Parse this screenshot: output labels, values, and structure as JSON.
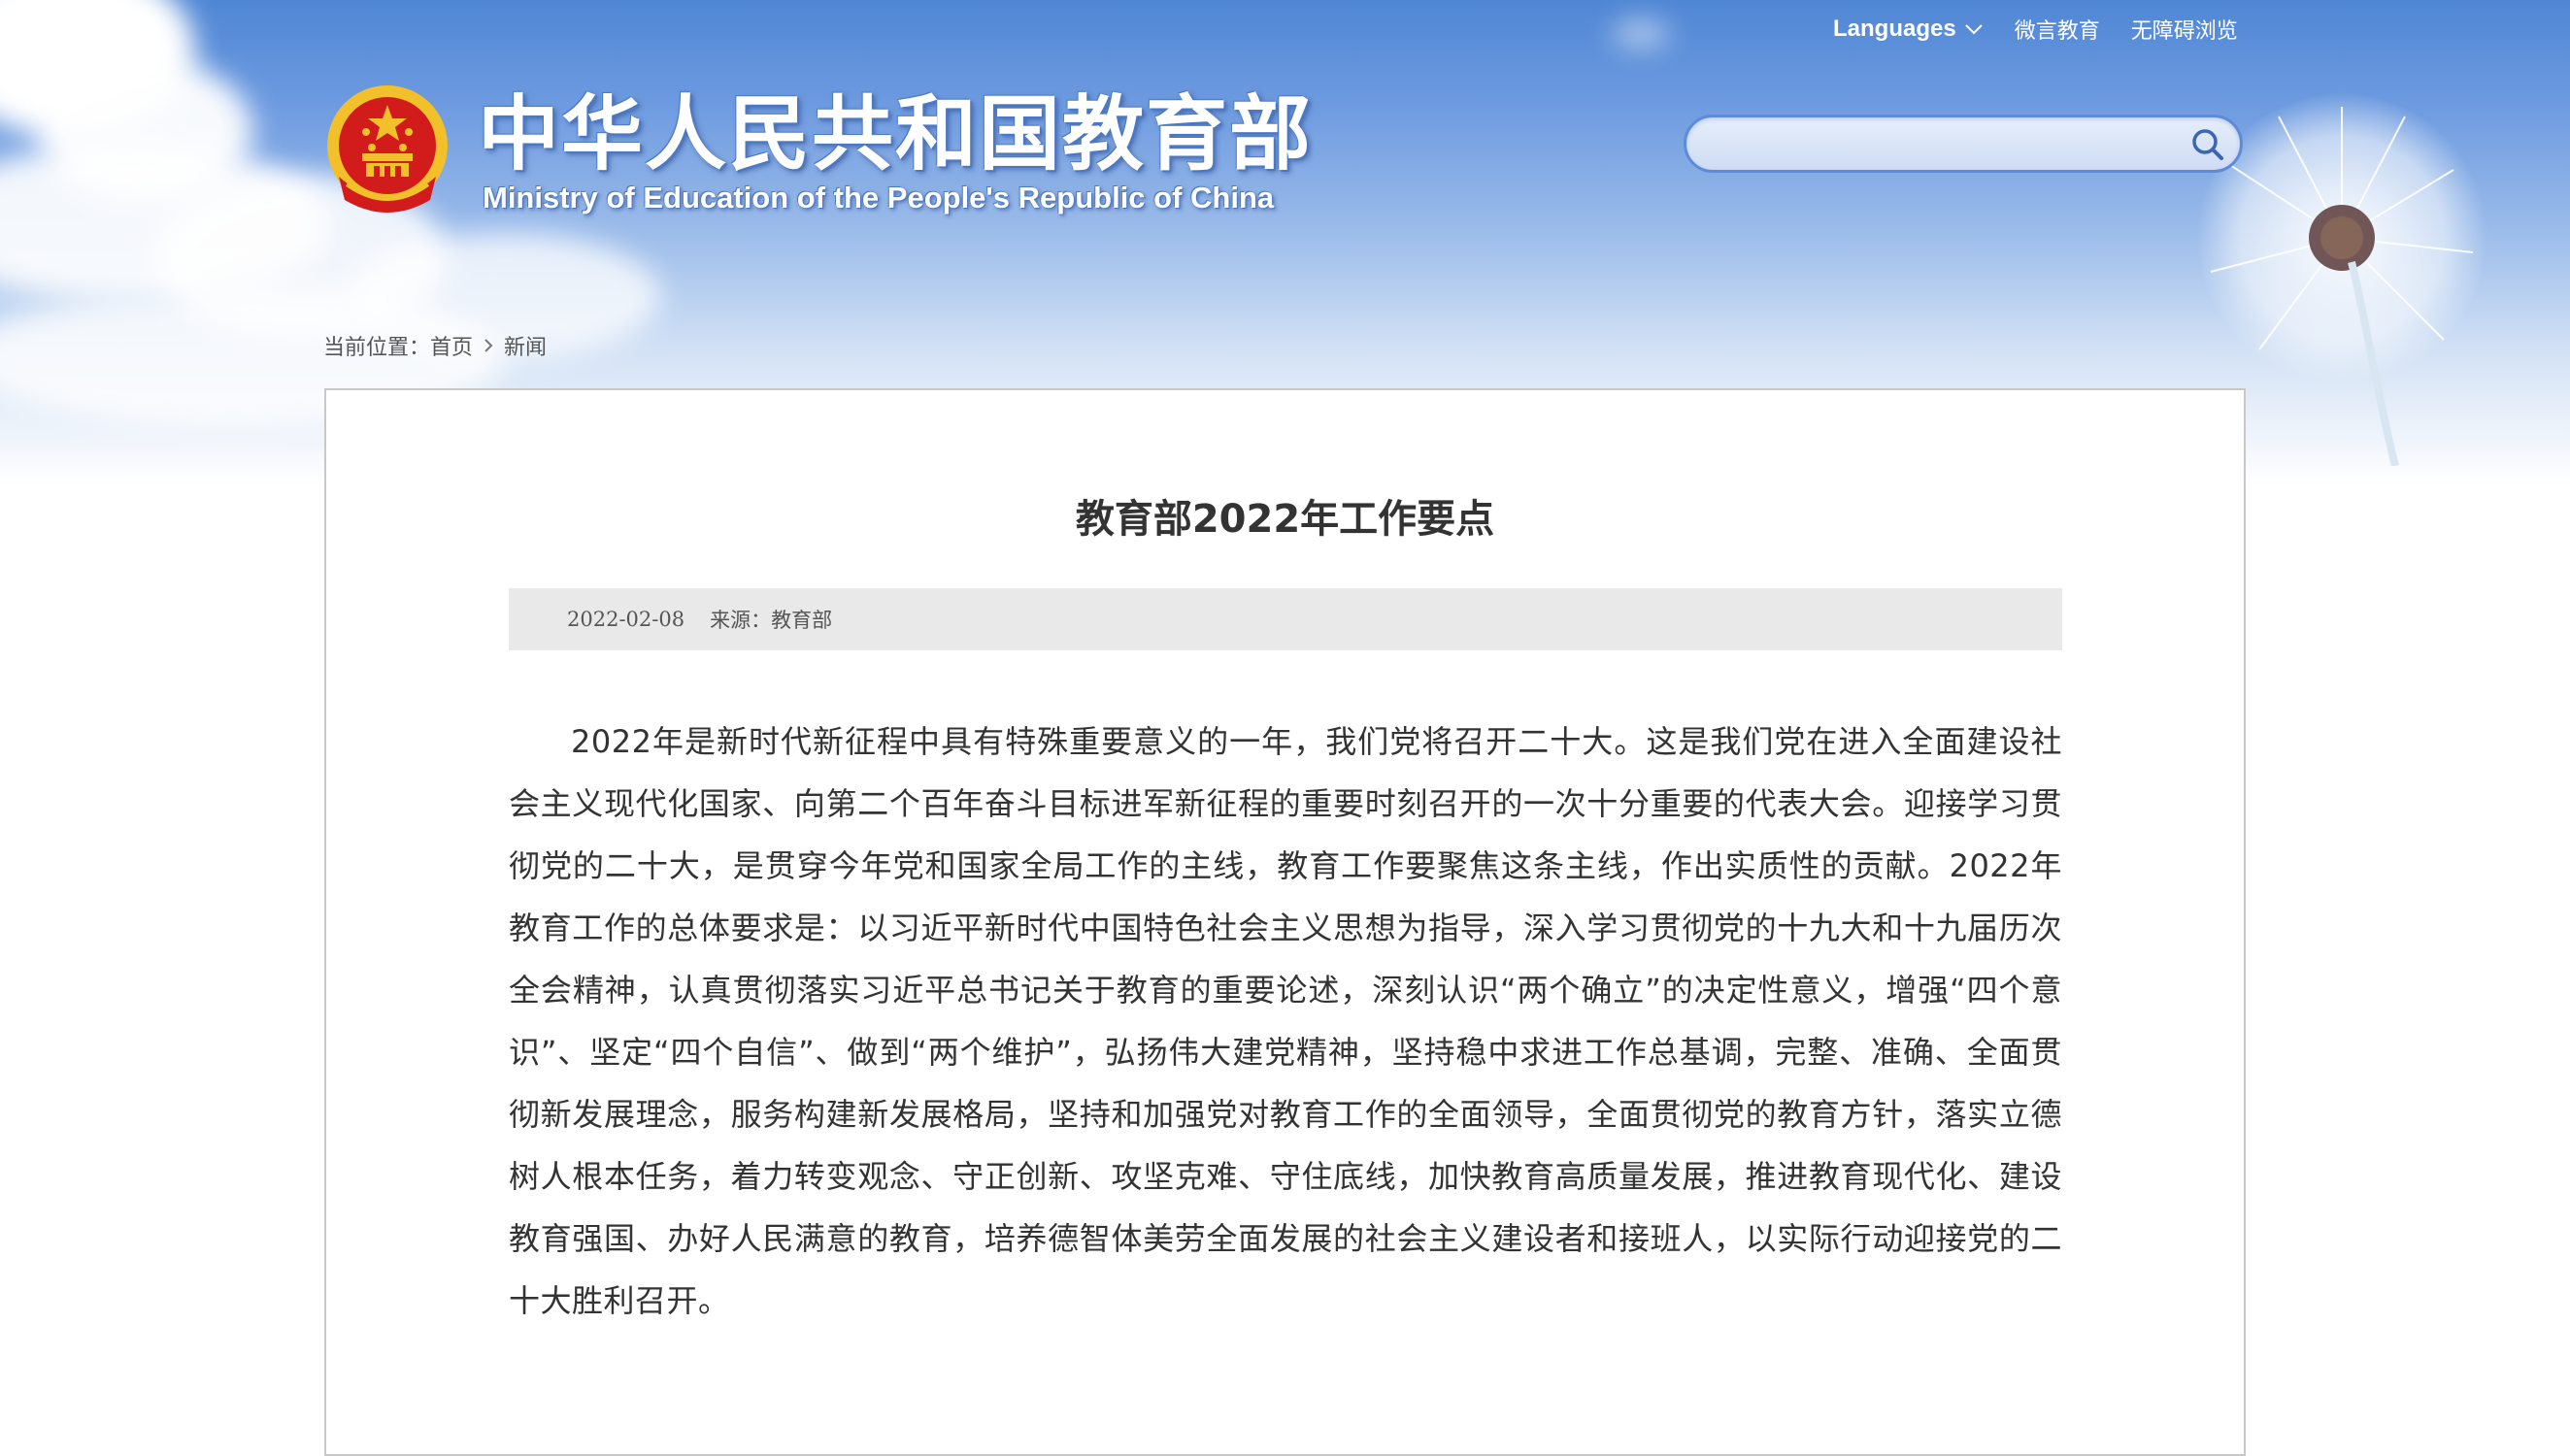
{
  "header": {
    "languages_label": "Languages",
    "links": [
      "微言教育",
      "无障碍浏览"
    ],
    "site_title": "中华人民共和国教育部",
    "site_subtitle": "Ministry of Education of the People's Republic of China"
  },
  "search": {
    "placeholder": "",
    "value": ""
  },
  "breadcrumb": {
    "label": "当前位置：",
    "items": [
      "首页",
      "新闻"
    ]
  },
  "article": {
    "title": "教育部2022年工作要点",
    "date": "2022-02-08",
    "source": "来源：教育部",
    "paragraph": "2022年是新时代新征程中具有特殊重要意义的一年，我们党将召开二十大。这是我们党在进入全面建设社会主义现代化国家、向第二个百年奋斗目标进军新征程的重要时刻召开的一次十分重要的代表大会。迎接学习贯彻党的二十大，是贯穿今年党和国家全局工作的主线，教育工作要聚焦这条主线，作出实质性的贡献。2022年教育工作的总体要求是：以习近平新时代中国特色社会主义思想为指导，深入学习贯彻党的十九大和十九届历次全会精神，认真贯彻落实习近平总书记关于教育的重要论述，深刻认识“两个确立”的决定性意义，增强“四个意识”、坚定“四个自信”、做到“两个维护”，弘扬伟大建党精神，坚持稳中求进工作总基调，完整、准确、全面贯彻新发展理念，服务构建新发展格局，坚持和加强党对教育工作的全面领导，全面贯彻党的教育方针，落实立德树人根本任务，着力转变观念、守正创新、攻坚克难、守住底线，加快教育高质量发展，推进教育现代化、建设教育强国、办好人民满意的教育，培养德智体美劳全面发展的社会主义建设者和接班人，以实际行动迎接党的二十大胜利召开。"
  },
  "icons": {
    "emblem": "national-emblem-icon",
    "search": "search-icon",
    "chevron": "chevron-down-icon",
    "breadcrumb_sep": "chevron-right-icon"
  },
  "colors": {
    "sky_top": "#4f86d4",
    "emblem_red": "#d21c1c",
    "emblem_gold": "#f2c02a",
    "text_dark": "#333333",
    "meta_bg": "#e9e9e9"
  }
}
